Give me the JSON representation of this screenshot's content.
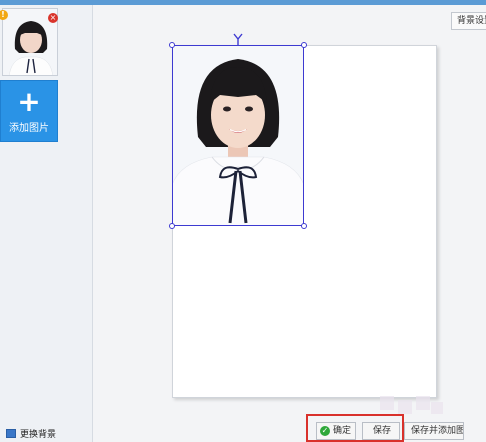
{
  "sidebar": {
    "add_label": "添加图片",
    "warn_badge": "!",
    "close_badge": "×",
    "bg_change_label": "更换背景"
  },
  "main": {
    "settings_label": "背景设置"
  },
  "buttons": {
    "ok_label": "确定",
    "save_label": "保存",
    "save2_label": "保存并添加图片"
  },
  "colors": {
    "accent": "#2a93e6",
    "frame": "#3d3ad1",
    "highlight": "#d9312b"
  }
}
